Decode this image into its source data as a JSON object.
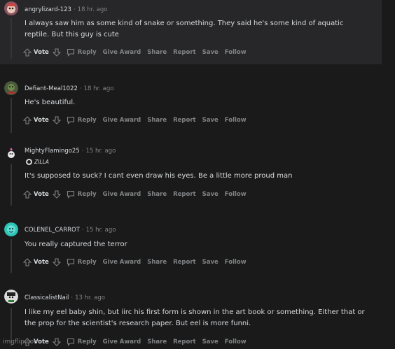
{
  "comments": [
    {
      "author": "angrylizard-123",
      "time": "18 hr. ago",
      "body": "I always saw him as some kind of snake or something. They said he's some kind of aquatic reptile. But this guy is cute"
    },
    {
      "author": "Defiant-Meal1022",
      "time": "18 hr. ago",
      "body": "He's beautiful."
    },
    {
      "author": "MightyFlamingo25",
      "time": "15 hr. ago",
      "flair": "ZILLA",
      "body": "It's supposed to suck? I cant even draw his eyes. Be a little more proud man"
    },
    {
      "author": "COLENEL_CARROT",
      "time": "15 hr. ago",
      "body": "You really captured the terror"
    },
    {
      "author": "ClassicalistNail",
      "time": "13 hr. ago",
      "body": "I like my eel baby shin, but iirc his first form is shown in the art book or something. Either that or the prop for the scientist's research paper. But eel is more funni."
    }
  ],
  "actions": {
    "vote": "Vote",
    "reply": "Reply",
    "give_award": "Give Award",
    "share": "Share",
    "report": "Report",
    "save": "Save",
    "follow": "Follow"
  },
  "separator": "·",
  "watermark": "imgflip.com",
  "colors": {
    "background": "#1a1a1b",
    "highlight_panel": "#272729",
    "text": "#d7dadc",
    "muted": "#818384"
  }
}
